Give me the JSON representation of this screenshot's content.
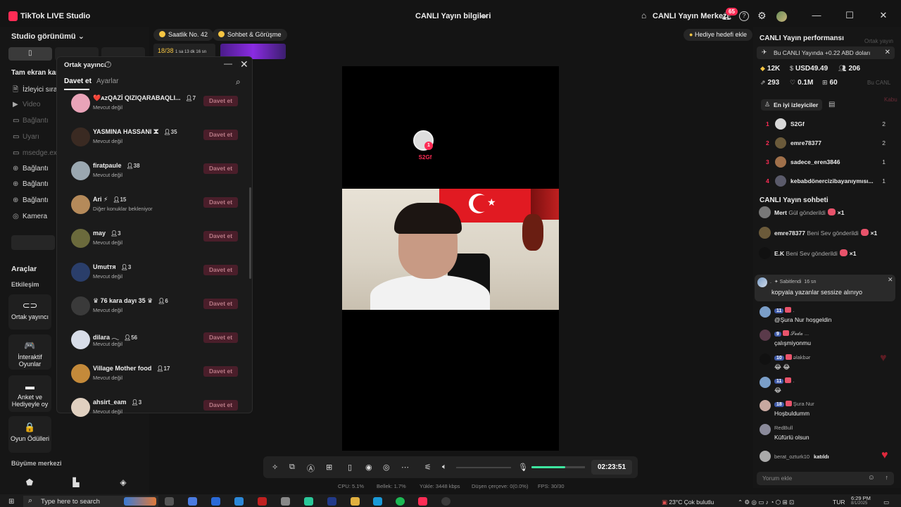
{
  "titlebar": {
    "app_name": "TikTok LIVE Studio",
    "center_title": "CANLI Yayın bilgileri",
    "live_center": "CANLI Yayın Merkezi",
    "notification_count": "65",
    "help": "?",
    "min": "—",
    "max": "☐",
    "close": "✕"
  },
  "left": {
    "studio_view": "Studio görünümü",
    "fullscreen_heading": "Tam ekran kam",
    "sources": [
      {
        "icon": "🗎",
        "label": "İzleyici sıral",
        "dim": false
      },
      {
        "icon": "▶",
        "label": "Video",
        "dim": true
      },
      {
        "icon": "▭",
        "label": "Bağlantı",
        "dim": true
      },
      {
        "icon": "▭",
        "label": "Uyarı",
        "dim": true
      },
      {
        "icon": "▭",
        "label": "msedge.exe",
        "dim": true
      },
      {
        "icon": "⊕",
        "label": "Bağlantı",
        "dim": false
      },
      {
        "icon": "⊕",
        "label": "Bağlantı",
        "dim": false
      },
      {
        "icon": "⊕",
        "label": "Bağlantı",
        "dim": false
      },
      {
        "icon": "◎",
        "label": "Kamera",
        "dim": false
      }
    ],
    "tools_title": "Araçlar",
    "interaction": "Etkileşim",
    "tools": [
      {
        "icon": "⊂⊃",
        "label": "Ortak yayıncı"
      },
      {
        "icon": "🎮",
        "label": "İnteraktif Oyunlar"
      },
      {
        "icon": "▬",
        "label": "Anket ve Hediyeyle oy"
      },
      {
        "icon": "🔒",
        "label": "Oyun Ödülleri"
      }
    ],
    "growth": "Büyüme merkezi"
  },
  "chips": {
    "hourly": "Saatlik No. 42",
    "chat_meet": "Sohbet & Görüşme",
    "gift_goal": "Hediye hedefi ekle",
    "mini_banner": "18/38",
    "mini_banner_sub": "1 sa 13 dk 16 sn"
  },
  "cohost": {
    "title": "Ortak yayıncı",
    "tab_invite": "Davet et",
    "tab_settings": "Ayarlar",
    "invite_label": "Davet et",
    "hosts": [
      {
        "name": "❤️ᴀzQAZİ QIZIQARABAQLI...",
        "count": "7",
        "status": "Mevcut değil",
        "color": "#e9a3b8"
      },
      {
        "name": "YASMINA HASSANI ⵣ",
        "count": "35",
        "status": "Mevcut değil",
        "color": "#3a2a22"
      },
      {
        "name": "firatpaule",
        "count": "38",
        "status": "Mevcut değil",
        "color": "#9aa7b0"
      },
      {
        "name": "Ari ⚡",
        "count": "15",
        "status": "Diğer konuklar bekleniyor",
        "color": "#b58a5a"
      },
      {
        "name": "may",
        "count": "3",
        "status": "Mevcut değil",
        "color": "#6b6a3c"
      },
      {
        "name": "Umutтя",
        "count": "3",
        "status": "Mevcut değil",
        "color": "#2a3e6a"
      },
      {
        "name": "♛ 76 kara dayı 35 ♛",
        "count": "6",
        "status": "Mevcut değil",
        "color": "#3a3a3a"
      },
      {
        "name": "dilara 𓂃",
        "count": "56",
        "status": "Mevcut değil",
        "color": "#d8dde8"
      },
      {
        "name": "Village Mother food",
        "count": "17",
        "status": "Mevcut değil",
        "color": "#c48a3a"
      },
      {
        "name": "ahsirt_eam",
        "count": "3",
        "status": "Mevcut değil",
        "color": "#e0d0c0"
      }
    ]
  },
  "preview": {
    "guest_name": "S2Gf",
    "guest_badge": "1"
  },
  "controls": {
    "timer": "02:23:51",
    "mic_level": 0.63,
    "stats": {
      "cpu": "CPU: 5.1%",
      "memory": "Bellek: 1.7%",
      "upload": "Yükle: 3448 kbps",
      "dropped": "Düşen çerçeve: 0(0.0%)",
      "fps": "FPS: 30/30"
    }
  },
  "performance": {
    "title": "CANLI Yayın performansı",
    "banner": "Bu CANLI Yayında +0.22 ABD doları",
    "diamonds": "12K",
    "usd": "USD49.49",
    "viewers": "206",
    "shares": "293",
    "likes": "0.1M",
    "gifts": "60"
  },
  "top_viewers": {
    "tab_label": "En iyi izleyiciler",
    "list": [
      {
        "rank": "1",
        "name": "S2Gf",
        "count": "2",
        "color": "#d8d8d8"
      },
      {
        "rank": "2",
        "name": "emre78377",
        "count": "2",
        "color": "#6b5a3a"
      },
      {
        "rank": "3",
        "name": "sadece_eren3846",
        "count": "1",
        "color": "#a0704a"
      },
      {
        "rank": "4",
        "name": "kebabdönercizibayanıymısı...",
        "count": "1",
        "color": "#5a5a6a"
      }
    ]
  },
  "chat": {
    "title": "CANLI Yayın sohbeti",
    "gifts": [
      {
        "user": "Mert",
        "action": "Gül gönderildi",
        "qty": "×1",
        "color": "#777"
      },
      {
        "user": "emre78377",
        "action": "Beni Sev gönderildi",
        "qty": "×1",
        "color": "#6b5a3a"
      },
      {
        "user": "E.K",
        "action": "Beni Sev gönderildi",
        "qty": "×1",
        "color": "#111"
      }
    ],
    "pinned": {
      "user": ".",
      "label": "Sabitlendi",
      "time": "16 sn",
      "text": "kopyala yazanlar sessize alınıyo"
    },
    "messages": [
      {
        "level": "11",
        "user": ".",
        "text": "@Şura Nur hoşgeldin",
        "color": "#7a9ec8"
      },
      {
        "level": "9",
        "user": "𝓢𝓮𝓭𝓪 ...",
        "text": "çalışmiyonmu",
        "color": "#5a3a4a"
      },
      {
        "level": "10",
        "user": "əlakbər",
        "text": "😂 😂",
        "color": "#111"
      },
      {
        "level": "11",
        "user": ".",
        "text": "😂",
        "color": "#7a9ec8"
      },
      {
        "level": "18",
        "user": "Şura Nur",
        "text": "Hoşbuldumm",
        "color": "#c8a8a0"
      },
      {
        "level": "",
        "user": "RedBull",
        "text": "Küfürlü olsun",
        "color": "#8a8a9a"
      },
      {
        "level": "",
        "user": "berat_ozturk10",
        "text": "katıldı",
        "color": "#aaa"
      }
    ],
    "input_placeholder": "Yorum ekle"
  },
  "ghost": {
    "line1": "Ortak yayın",
    "line2": "Bu CANL",
    "line3": "Kabu"
  },
  "taskbar": {
    "search_placeholder": "Type here to search",
    "weather": "23°C  Çok bulutlu",
    "lang": "TUR",
    "time": "6:29 PM",
    "date": "8/1/2025"
  }
}
